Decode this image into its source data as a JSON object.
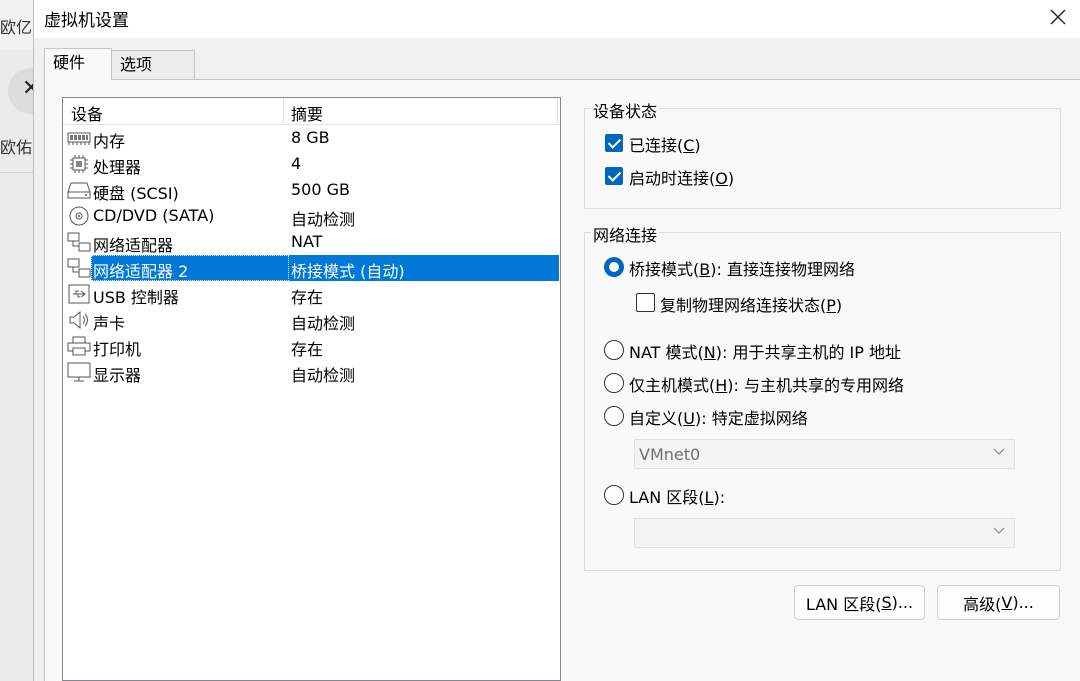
{
  "background_app": {
    "text1": "欧亿",
    "text2": "欧佑"
  },
  "window": {
    "title": "虚拟机设置"
  },
  "tabs": [
    {
      "label": "硬件"
    },
    {
      "label": "选项"
    }
  ],
  "device_list": {
    "headers": {
      "device": "设备",
      "summary": "摘要"
    },
    "items": [
      {
        "icon": "memory-icon",
        "name": "内存",
        "summary": "8 GB"
      },
      {
        "icon": "processor-icon",
        "name": "处理器",
        "summary": "4"
      },
      {
        "icon": "harddisk-icon",
        "name": "硬盘 (SCSI)",
        "summary": "500 GB"
      },
      {
        "icon": "cd-dvd-icon",
        "name": "CD/DVD (SATA)",
        "summary": "自动检测"
      },
      {
        "icon": "network-adapter-icon",
        "name": "网络适配器",
        "summary": "NAT"
      },
      {
        "icon": "network-adapter-icon",
        "name": "网络适配器 2",
        "summary": "桥接模式 (自动)",
        "selected": true
      },
      {
        "icon": "usb-icon",
        "name": "USB 控制器",
        "summary": "存在"
      },
      {
        "icon": "sound-card-icon",
        "name": "声卡",
        "summary": "自动检测"
      },
      {
        "icon": "printer-icon",
        "name": "打印机",
        "summary": "存在"
      },
      {
        "icon": "display-icon",
        "name": "显示器",
        "summary": "自动检测"
      }
    ]
  },
  "device_status": {
    "title": "设备状态",
    "connected": {
      "label": "已连接(",
      "key": "C",
      "suffix": ")",
      "checked": true
    },
    "connect_at_power_on": {
      "label": "启动时连接(",
      "key": "O",
      "suffix": ")",
      "checked": true
    }
  },
  "network_connection": {
    "title": "网络连接",
    "bridged": {
      "label": "桥接模式(",
      "key": "B",
      "suffix": "): 直接连接物理网络",
      "selected": true
    },
    "replicate": {
      "label": "复制物理网络连接状态(",
      "key": "P",
      "suffix": ")",
      "checked": false
    },
    "nat": {
      "label": "NAT 模式(",
      "key": "N",
      "suffix": "): 用于共享主机的 IP 地址",
      "selected": false
    },
    "host_only": {
      "label": "仅主机模式(",
      "key": "H",
      "suffix": "): 与主机共享的专用网络",
      "selected": false
    },
    "custom": {
      "label": "自定义(",
      "key": "U",
      "suffix": "): 特定虚拟网络",
      "selected": false
    },
    "custom_select_value": "VMnet0",
    "lan_segment": {
      "label": "LAN 区段(",
      "key": "L",
      "suffix": "):",
      "selected": false
    },
    "lan_select_value": ""
  },
  "buttons": {
    "lan_segments": {
      "label": "LAN 区段(",
      "key": "S",
      "suffix": ")..."
    },
    "advanced": {
      "label": "高级(",
      "key": "V",
      "suffix": ")..."
    }
  },
  "colors": {
    "accent": "#0067c0",
    "selection": "#0078d7"
  }
}
